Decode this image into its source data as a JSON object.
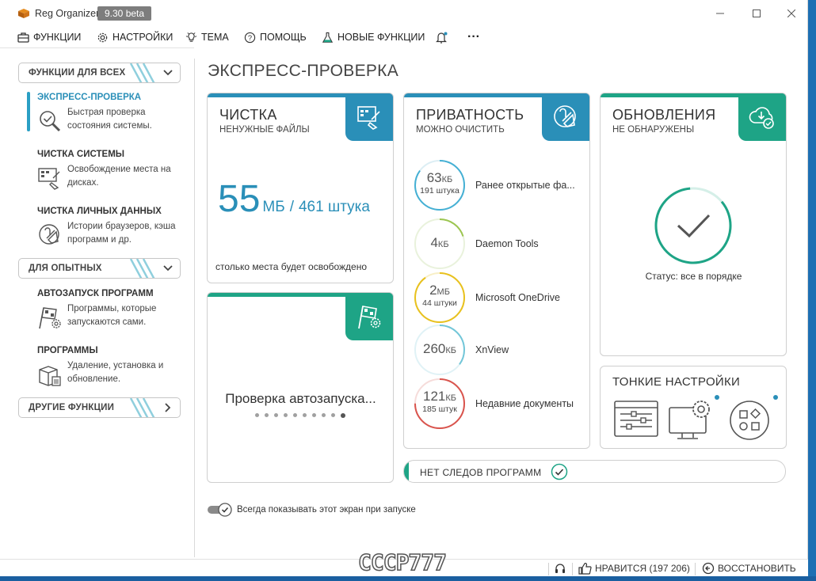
{
  "window": {
    "app_title": "Reg Organizer",
    "version": "9.30 beta",
    "controls": {
      "minimize": "—",
      "maximize": "☐",
      "close": "✕"
    }
  },
  "menu": {
    "items": [
      {
        "label": "ФУНКЦИИ",
        "icon": "toolbox-icon"
      },
      {
        "label": "НАСТРОЙКИ",
        "icon": "gear-icon"
      },
      {
        "label": "ТЕМА",
        "icon": "theme-icon"
      },
      {
        "label": "ПОМОЩЬ",
        "icon": "help-icon"
      },
      {
        "label": "НОВЫЕ ФУНКЦИИ",
        "icon": "flask-icon"
      }
    ],
    "bell_icon": "bell-icon",
    "more": "···"
  },
  "sidebar": {
    "group_all": "ФУНКЦИИ ДЛЯ ВСЕХ",
    "group_advanced": "ДЛЯ ОПЫТНЫХ",
    "group_other": "ДРУГИЕ ФУНКЦИИ",
    "items": [
      {
        "title": "ЭКСПРЕСС-ПРОВЕРКА",
        "desc": "Быстрая проверка состояния системы.",
        "active": true
      },
      {
        "title": "ЧИСТКА СИСТЕМЫ",
        "desc": "Освобождение места на дисках."
      },
      {
        "title": "ЧИСТКА ЛИЧНЫХ ДАННЫХ",
        "desc": "Истории браузеров, кэша программ и др."
      },
      {
        "title": "АВТОЗАПУСК ПРОГРАММ",
        "desc": "Программы, которые запускаются сами."
      },
      {
        "title": "ПРОГРАММЫ",
        "desc": "Удаление, установка и обновление."
      }
    ]
  },
  "main": {
    "page_title": "ЭКСПРЕСС-ПРОВЕРКА",
    "cleanup": {
      "title": "ЧИСТКА",
      "subtitle": "НЕНУЖНЫЕ ФАЙЛЫ",
      "size": "55",
      "size_unit": "МБ",
      "separator": "/",
      "count": "461 штука",
      "footer": "столько места будет освобождено",
      "color": "#2a8fb8"
    },
    "autorun": {
      "loading": "Проверка автозапуска...",
      "color": "#1ea486"
    },
    "privacy": {
      "title": "ПРИВАТНОСТЬ",
      "subtitle": "МОЖНО ОЧИСТИТЬ",
      "color": "#2a8fb8",
      "rows": [
        {
          "value": "63",
          "unit": "КБ",
          "count": "191 штука",
          "name": "Ранее открытые фа...",
          "color": "#45b0d4",
          "fill": 0.85
        },
        {
          "value": "4",
          "unit": "КБ",
          "count": "",
          "name": "Daemon Tools",
          "color": "#9cc550",
          "fill": 0.2
        },
        {
          "value": "2",
          "unit": "МБ",
          "count": "44 штуки",
          "name": "Microsoft OneDrive",
          "color": "#e8c11e",
          "fill": 0.9
        },
        {
          "value": "260",
          "unit": "КБ",
          "count": "",
          "name": "XnView",
          "color": "#72c6d8",
          "fill": 0.35
        },
        {
          "value": "121",
          "unit": "КБ",
          "count": "185 штук",
          "name": "Недавние документы",
          "color": "#d9544d",
          "fill": 0.75
        }
      ]
    },
    "updates": {
      "title": "ОБНОВЛЕНИЯ",
      "subtitle": "НЕ ОБНАРУЖЕНЫ",
      "status": "Статус: все в порядке",
      "color": "#1ea486"
    },
    "tweaks": {
      "title": "ТОНКИЕ НАСТРОЙКИ",
      "icons": [
        "settings-panel-icon",
        "monitor-gear-icon",
        "apps-grid-icon"
      ]
    },
    "no_traces": "НЕТ СЛЕДОВ ПРОГРАММ",
    "show_on_startup": "Всегда показывать этот экран при запуске",
    "show_on_startup_checked": true
  },
  "statusbar": {
    "like": "НРАВИТСЯ (197 206)",
    "restore": "ВОССТАНОВИТЬ",
    "watermark": "СССР777"
  }
}
